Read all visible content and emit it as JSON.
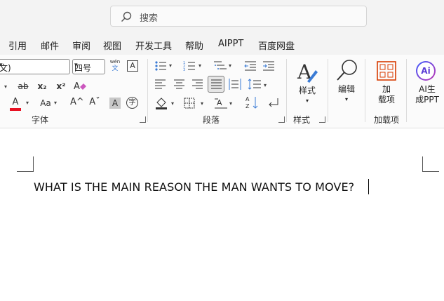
{
  "search": {
    "placeholder": "搜索"
  },
  "menu": [
    "引用",
    "邮件",
    "审阅",
    "视图",
    "开发工具",
    "帮助",
    "AIPPT",
    "百度网盘"
  ],
  "font": {
    "name_value": "文)",
    "size_value": "四号",
    "phonetic_top": "wén",
    "phonetic_bottom": "文",
    "char_border": "A",
    "strikethrough": "ab",
    "subscript": "x₂",
    "superscript": "x²",
    "font_color": "A",
    "change_case": "Aa",
    "grow": "A^",
    "shrink": "Aˇ",
    "shading": "A",
    "enclose": "字",
    "group_label": "字体"
  },
  "paragraph": {
    "group_label": "段落"
  },
  "styles": {
    "button_label": "样式",
    "group_label": "样式"
  },
  "editing": {
    "button_label": "编辑"
  },
  "addins": {
    "button_label_1": "加",
    "button_label_2": "载项",
    "group_label": "加载项"
  },
  "ai": {
    "badge": "Ai",
    "button_label_1": "AI生",
    "button_label_2": "成PPT"
  },
  "document": {
    "text": "WHAT IS THE MAIN REASON THE MAN WANTS TO MOVE?"
  },
  "colors": {
    "font_color_bar": "#e81123",
    "ai_gradient_start": "#3b5bff",
    "ai_gradient_end": "#c239b3",
    "addins_accent": "#d83b01"
  }
}
